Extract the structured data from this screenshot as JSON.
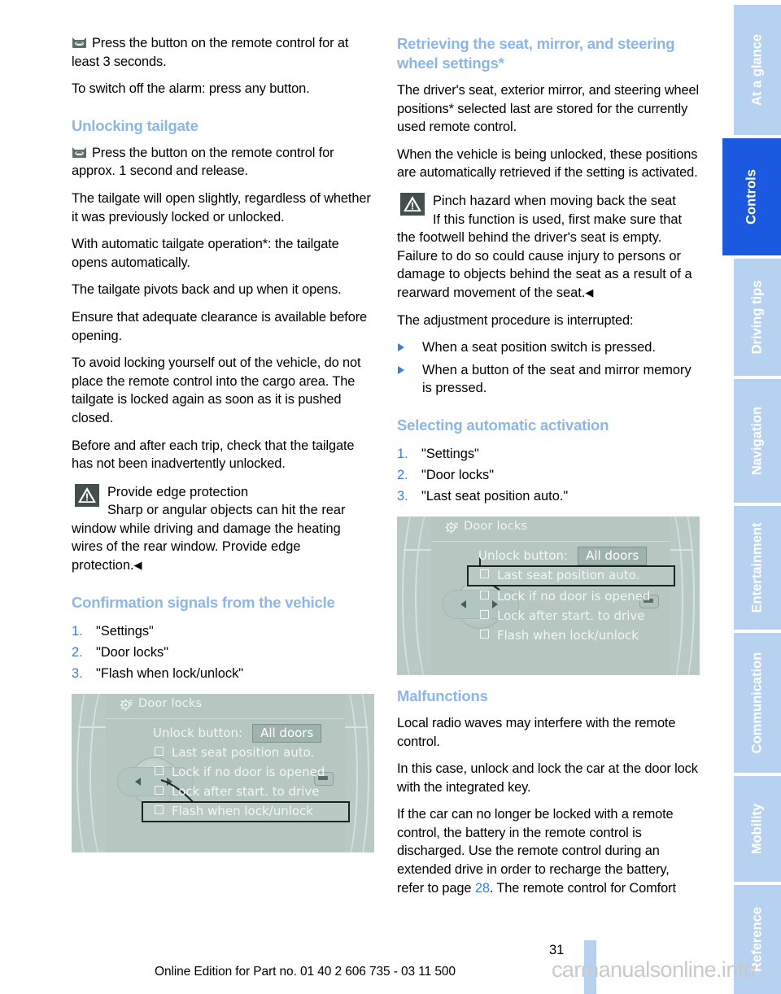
{
  "document": {
    "page_number": "31",
    "footer": "Online Edition for Part no. 01 40 2 606 735 - 03 11 500",
    "watermark": "carmanualsonline.info"
  },
  "nav_tabs": [
    {
      "label": "At a glance",
      "active": false
    },
    {
      "label": "Controls",
      "active": true
    },
    {
      "label": "Driving tips",
      "active": false
    },
    {
      "label": "Navigation",
      "active": false
    },
    {
      "label": "Entertainment",
      "active": false
    },
    {
      "label": "Communication",
      "active": false
    },
    {
      "label": "Mobility",
      "active": false
    },
    {
      "label": "Reference",
      "active": false
    }
  ],
  "left_column": {
    "intro_para_1": "Press the button on the remote control for at least 3 seconds.",
    "intro_para_2": "To switch off the alarm: press any button.",
    "heading_unlocking_tailgate": "Unlocking tailgate",
    "p1": "Press the button on the remote control for approx. 1 second and release.",
    "p2": "The tailgate will open slightly, regardless of whether it was previously locked or unlocked.",
    "p3": "With automatic tailgate operation*: the tailgate opens automatically.",
    "p4": "The tailgate pivots back and up when it opens.",
    "p5": "Ensure that adequate clearance is available before opening.",
    "p6": "To avoid locking yourself out of the vehicle, do not place the remote control into the cargo area. The tailgate is locked again as soon as it is pushed closed.",
    "p7": "Before and after each trip, check that the tailgate has not been inadvertently unlocked.",
    "warning": {
      "title": "Provide edge protection",
      "body": "Sharp or angular objects can hit the rear window while driving and damage the heating wires of the rear window. Provide edge protection.",
      "end_marker": "◀"
    },
    "heading_confirmation": "Confirmation signals from the vehicle",
    "steps": [
      {
        "num": "1.",
        "label": "\"Settings\""
      },
      {
        "num": "2.",
        "label": "\"Door locks\""
      },
      {
        "num": "3.",
        "label": "\"Flash when lock/unlock\""
      }
    ]
  },
  "right_column": {
    "heading_retrieving": "Retrieving the seat, mirror, and steering wheel settings*",
    "p1": "The driver's seat, exterior mirror, and steering wheel positions* selected last are stored for the currently used remote control.",
    "p2": "When the vehicle is being unlocked, these positions are automatically retrieved if the setting is activated.",
    "warning": {
      "title": "Pinch hazard when moving back the seat",
      "body": "If this function is used, first make sure that the footwell behind the driver's seat is empty. Failure to do so could cause injury to persons or damage to objects behind the seat as a result of a rearward movement of the seat.",
      "end_marker": "◀"
    },
    "p3": "The adjustment procedure is interrupted:",
    "bullets": [
      "When a seat position switch is pressed.",
      "When a button of the seat and mirror memory is pressed."
    ],
    "heading_selecting": "Selecting automatic activation",
    "steps": [
      {
        "num": "1.",
        "label": "\"Settings\""
      },
      {
        "num": "2.",
        "label": "\"Door locks\""
      },
      {
        "num": "3.",
        "label": "\"Last seat position auto.\""
      }
    ],
    "heading_malfunctions": "Malfunctions",
    "m1": "Local radio waves may interfere with the remote control.",
    "m2": "In this case, unlock and lock the car at the door lock with the integrated key.",
    "m3_before": "If the car can no longer be locked with a remote control, the battery in the remote control is discharged. Use the remote control during an extended drive in order to recharge the battery, refer to page ",
    "m3_link": "28",
    "m3_after": ". The remote control for Comfort"
  },
  "mmi_left": {
    "title": "Door locks",
    "unlock_label": "Unlock button:",
    "unlock_value": "All doors",
    "options": [
      {
        "label": "Last seat position auto.",
        "highlighted": false
      },
      {
        "label": "Lock if no door is opened",
        "highlighted": false
      },
      {
        "label": "Lock after start. to drive",
        "highlighted": false
      },
      {
        "label": "Flash when lock/unlock",
        "highlighted": true
      }
    ]
  },
  "mmi_right": {
    "title": "Door locks",
    "unlock_label": "Unlock button:",
    "unlock_value": "All doors",
    "options": [
      {
        "label": "Last seat position auto.",
        "highlighted": true
      },
      {
        "label": "Lock if no door is opened",
        "highlighted": false
      },
      {
        "label": "Lock after start. to drive",
        "highlighted": false
      },
      {
        "label": "Flash when lock/unlock",
        "highlighted": false
      }
    ]
  },
  "colors": {
    "heading_blue": "#8cb6e8",
    "link_blue": "#3b7ddd",
    "tab_inactive": "#b7d2f0",
    "tab_active": "#1b5ae0",
    "mmi_bg": "#b6c7c2",
    "warning_icon_bg": "#434e4e"
  }
}
